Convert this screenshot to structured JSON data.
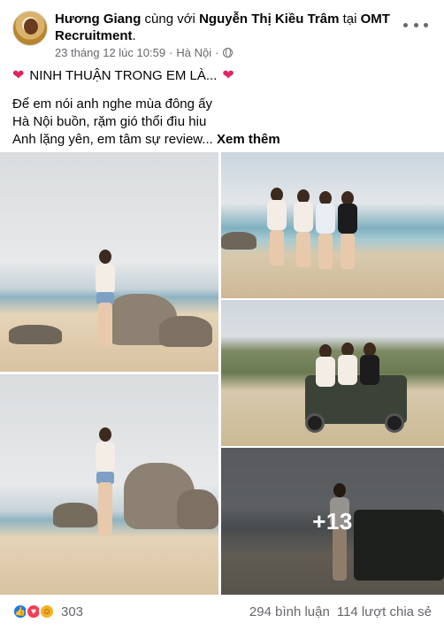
{
  "post": {
    "author": "Hương Giang",
    "with_text": "cùng với",
    "tagged": "Nguyễn Thị Kiều Trâm",
    "at_text": "tại",
    "location_page": "OMT Recruitment",
    "location_suffix": ".",
    "timestamp": "23 tháng 12 lúc 10:59",
    "separator": "·",
    "place": "Hà Nội",
    "privacy_icon": "globe-icon",
    "more_icon": "more-horizontal-icon"
  },
  "caption": {
    "title": "NINH THUẬN TRONG EM LÀ...",
    "heart_icon": "red-heart-icon",
    "lines": [
      "Để em nói anh nghe mùa đông ấy",
      "Hà Nội buồn, rặm gió thổi đìu hiu",
      "Anh lặng yên, em tâm sự review..."
    ],
    "see_more": "Xem thêm"
  },
  "photos": {
    "count": 5,
    "more_overlay": "+13"
  },
  "footer": {
    "reactions": [
      "like-icon",
      "love-icon",
      "care-icon"
    ],
    "reaction_count": "303",
    "comments": "294 bình luận",
    "shares": "114 lượt chia sẻ"
  },
  "colors": {
    "accent": "#1877f2",
    "heart": "#e0245e",
    "secondary_text": "#65676b"
  }
}
